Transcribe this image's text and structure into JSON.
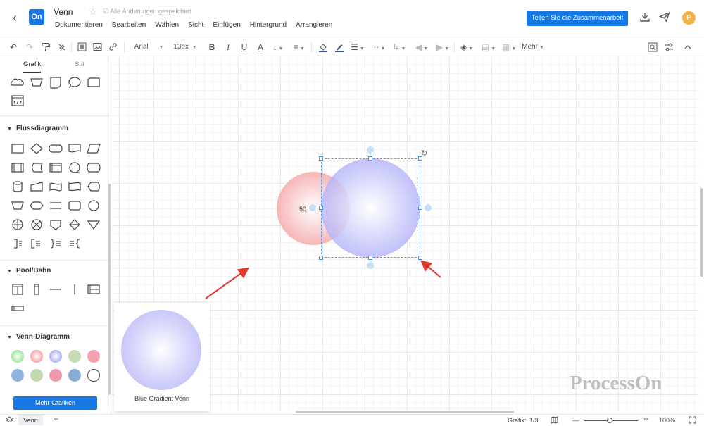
{
  "header": {
    "logo": "On",
    "title": "Venn",
    "saved_status": "Alle Änderungen gespeichert",
    "menu": [
      "Dokumentieren",
      "Bearbeiten",
      "Wählen",
      "Sicht",
      "Einfügen",
      "Hintergrund",
      "Arrangieren"
    ],
    "share_button": "Teilen Sie die Zusammenarbeit",
    "avatar_initial": "P"
  },
  "toolbar": {
    "font": "Arial",
    "font_size": "13px",
    "bold": "B",
    "italic": "I",
    "underline": "U",
    "text_color": "A",
    "more": "Mehr"
  },
  "sidebar": {
    "tabs": [
      "Grafik",
      "Stil"
    ],
    "sections": [
      "Flussdiagramm",
      "Pool/Bahn",
      "Venn-Diagramm"
    ],
    "more_button": "Mehr Grafiken"
  },
  "canvas": {
    "value_label": "50",
    "preview_label": "Blue Gradient Venn",
    "watermark": "ProcessOn"
  },
  "statusbar": {
    "page_tab": "Venn",
    "add_page": "+",
    "graphic_label": "Grafik:",
    "graphic_count": "1/3",
    "zoom": "100%",
    "zoom_out": "—",
    "zoom_in": "+"
  },
  "colors": {
    "accent": "#1677e5",
    "red_circle": "#f6aaac",
    "blue_circle": "#b4b4f4",
    "arrow": "#e03a2f"
  },
  "icons": [
    "back-icon",
    "star-icon",
    "check-icon",
    "download-icon",
    "send-icon",
    "undo-icon",
    "redo-icon",
    "format-painter-icon",
    "clear-format-icon",
    "fill-color-icon",
    "line-color-icon",
    "layer-icon",
    "search-icon",
    "settings-icon",
    "collapse-icon",
    "map-icon",
    "fullscreen-icon",
    "rotate-icon"
  ]
}
